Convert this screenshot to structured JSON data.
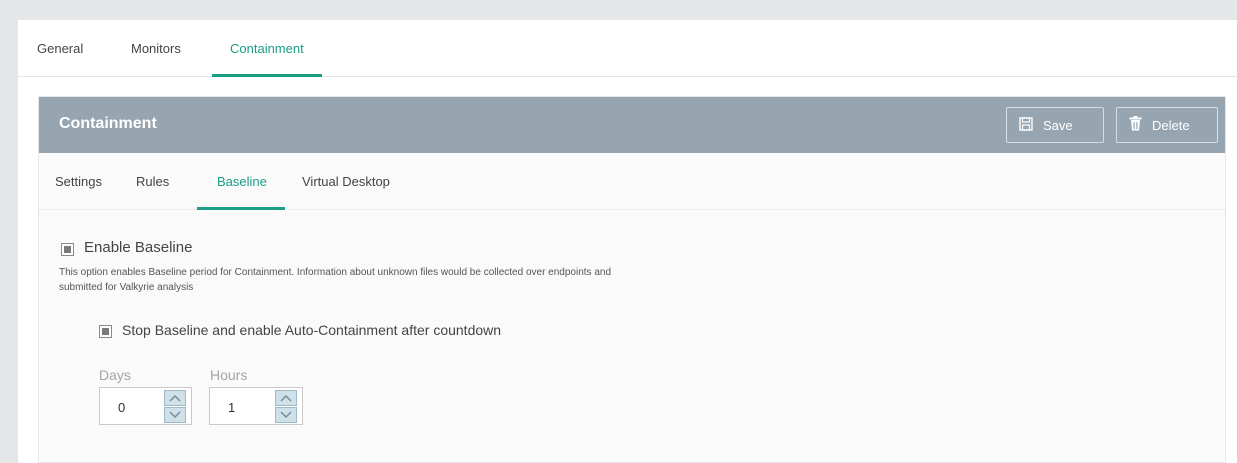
{
  "top_tabs": [
    {
      "label": "General"
    },
    {
      "label": "Monitors"
    },
    {
      "label": "Containment"
    }
  ],
  "card": {
    "title": "Containment",
    "save_label": "Save",
    "delete_label": "Delete"
  },
  "sub_tabs": [
    {
      "label": "Settings"
    },
    {
      "label": "Rules"
    },
    {
      "label": "Baseline"
    },
    {
      "label": "Virtual Desktop"
    }
  ],
  "baseline": {
    "enable_label": "Enable Baseline",
    "enable_checked": true,
    "description": "This option enables Baseline period for Containment. Information about unknown files would be collected over endpoints and submitted for Valkyrie analysis",
    "stop_label": "Stop Baseline and enable Auto-Containment after countdown",
    "stop_checked": true,
    "days_label": "Days",
    "days_value": "0",
    "hours_label": "Hours",
    "hours_value": "1"
  },
  "icons": {
    "save": "floppy-disk-icon",
    "delete": "trash-icon",
    "up": "chevron-up-icon",
    "down": "chevron-down-icon"
  },
  "colors": {
    "accent": "#1a9e86",
    "header_bg": "#96a5b0"
  }
}
